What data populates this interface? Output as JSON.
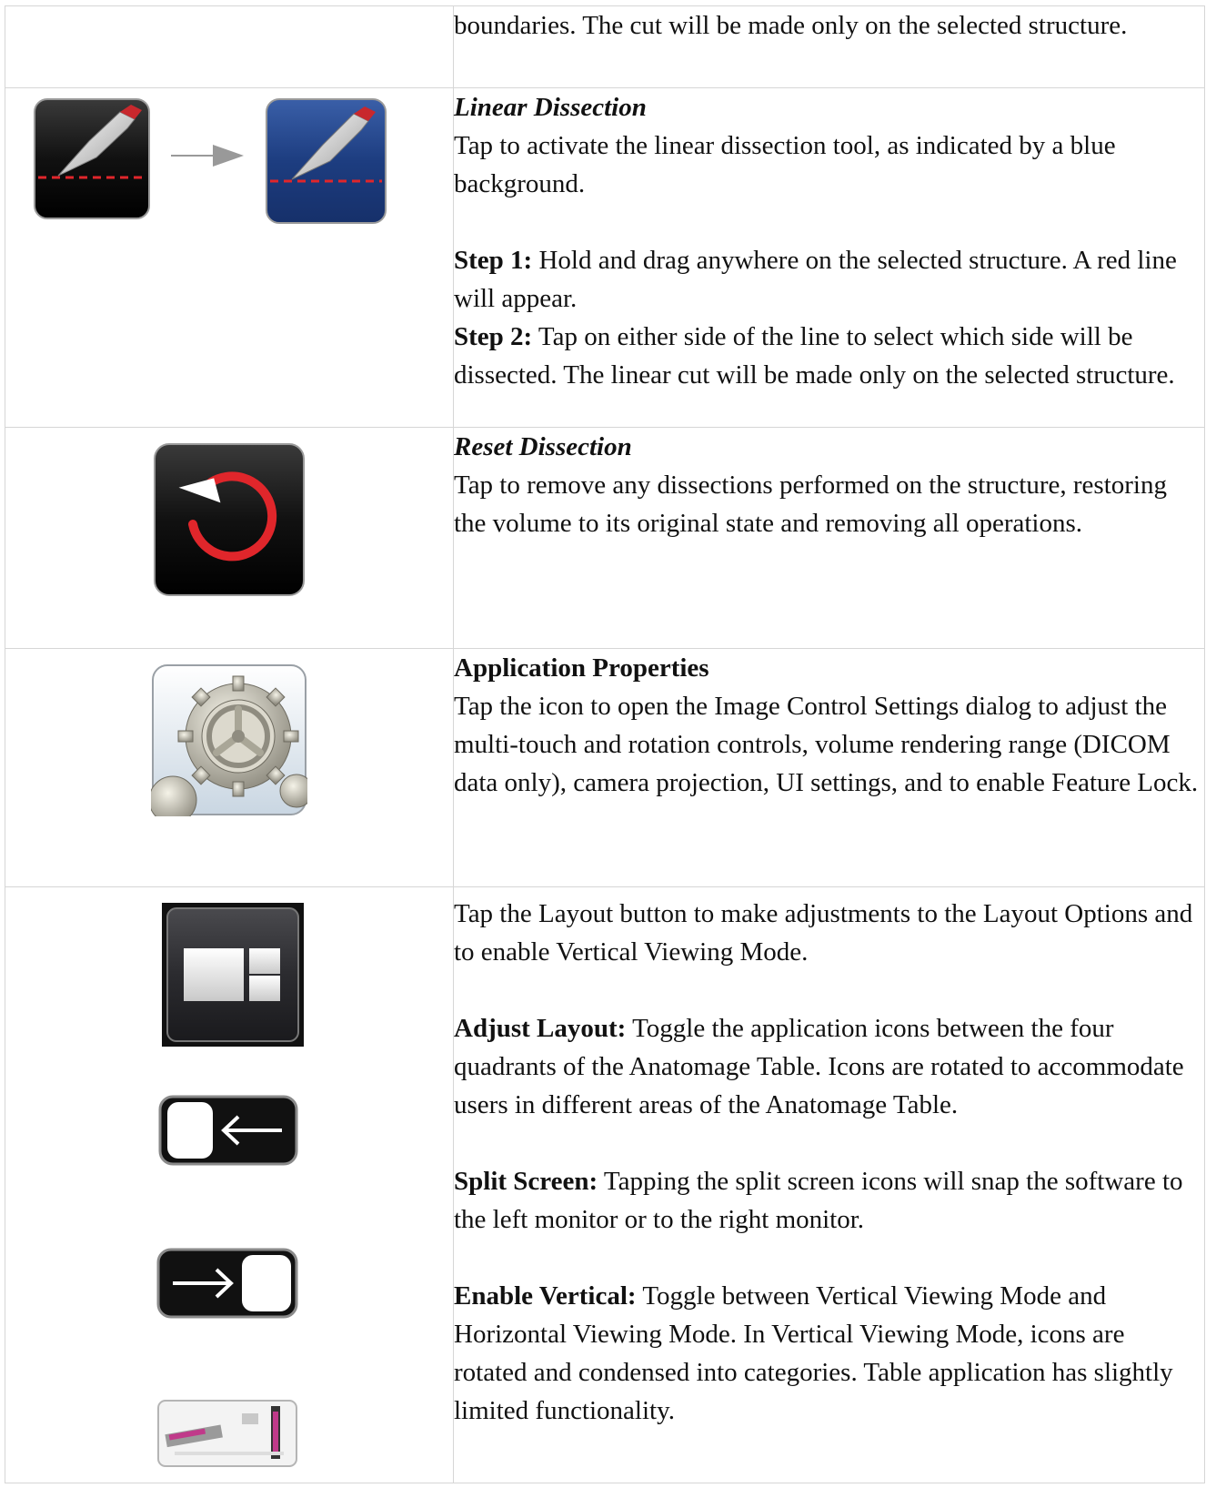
{
  "rows": [
    {
      "text": "boundaries.  The cut will be made only on the selected structure."
    },
    {
      "title": "Linear Dissection",
      "desc": "Tap to activate the linear dissection tool, as indicated by a blue background.",
      "step1_label": "Step 1:",
      "step1_text": " Hold and drag anywhere on the selected structure. A red line will appear.",
      "step2_label": "Step 2:",
      "step2_text": " Tap on either side of the line to select which side will be dissected.  The linear cut will be made only on the selected structure.",
      "icons": [
        "scalpel-inactive-icon",
        "arrow-right-icon",
        "scalpel-active-icon"
      ]
    },
    {
      "title": "Reset Dissection",
      "desc": "Tap to remove any dissections performed on the structure, restoring the volume to its original state and removing all operations.",
      "icons": [
        "reset-icon"
      ]
    },
    {
      "title": "Application Properties",
      "desc": "Tap the icon to open the Image Control Settings dialog to adjust the multi-touch and rotation controls, volume rendering range (DICOM data only), camera projection, UI settings, and to enable Feature Lock.",
      "icons": [
        "gear-icon"
      ]
    },
    {
      "desc": "Tap the Layout button to make adjustments to the Layout Options and to enable Vertical Viewing Mode.",
      "adjust_label": "Adjust Layout:",
      "adjust_text": " Toggle the application icons between the four quadrants of the Anatomage Table. Icons are rotated to accommodate users in different areas of the Anatomage Table.",
      "split_label": "Split Screen:",
      "split_text": " Tapping the split screen icons will snap the software to the left monitor or to the right monitor.",
      "vertical_label": "Enable Vertical:",
      "vertical_text": " Toggle between Vertical Viewing Mode and Horizontal Viewing Mode. In Vertical Viewing Mode, icons are rotated and condensed into categories. Table application has slightly limited functionality.",
      "icons": [
        "layout-icon",
        "snap-left-icon",
        "snap-right-icon",
        "vertical-mode-icon"
      ]
    }
  ],
  "colors": {
    "border": "#d6d6d6",
    "dark_icon": "#111111",
    "active_blue": "#1d3d80",
    "accent_red": "#e0262b"
  }
}
